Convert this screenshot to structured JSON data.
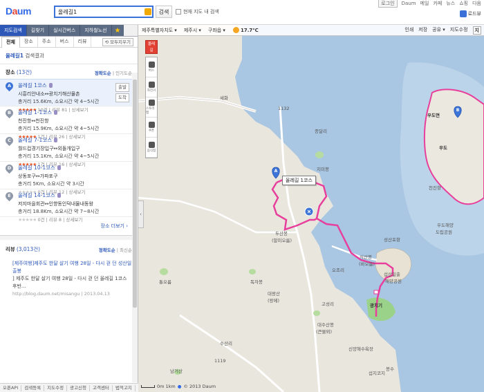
{
  "header": {
    "logo_daum": "Daum",
    "logo_map": "지도",
    "search_value": "올레길1",
    "search_button": "검색",
    "in_map_label": "현재 지도 내 검색",
    "util_links": [
      "로그인",
      "Daum",
      "메일",
      "카페",
      "뉴스",
      "쇼핑",
      "다음"
    ],
    "road_view": "로드뷰"
  },
  "left": {
    "nav_tabs": [
      "지도검색",
      "길찾기",
      "실시간버스",
      "지하철노선"
    ],
    "sub_tabs": [
      "전체",
      "장소",
      "주소",
      "버스",
      "리뷰"
    ],
    "clear_all": "모두지우기",
    "result_query": "올레길1",
    "result_suffix": "검색결과",
    "places_title": "장소",
    "places_count": "(13건)",
    "sort_accuracy": "정확도순",
    "sort_popular": "인기도순",
    "places": [
      {
        "badge": "A",
        "name": "올레길 1코스",
        "route": "시흥리안내소↔광치기해산물촌",
        "dist": "총거리 15.6Km, 소요시간 약 4~5시간",
        "stars": "★★★★★",
        "meta": "10건 | 리뷰 81 | 상세보기",
        "empty": false
      },
      {
        "badge": "B",
        "name": "올레길 1-1코스",
        "route": "천진항↔천진항",
        "dist": "총거리 15.9Km, 소요시간 약 4~5시간",
        "stars": "★★★★★",
        "meta": "1건 | 리뷰 26 | 상세보기",
        "empty": false
      },
      {
        "badge": "C",
        "name": "올레길 7-1코스",
        "route": "월드컵경기장입구↔외돌개입구",
        "dist": "총거리 15.1Km, 소요시간 약 4~5시간",
        "stars": "★★★★★",
        "meta": "1건 | 리뷰 16 | 상세보기",
        "empty": false
      },
      {
        "badge": "D",
        "name": "올레길 10-1코스",
        "route": "상동포구↔가파포구",
        "dist": "총거리 5Km, 소요시간 약 3시간",
        "stars": "★★★★★",
        "meta": "0건 | 리뷰 12 | 상세보기",
        "empty": true
      },
      {
        "badge": "E",
        "name": "올레길 14-1코스",
        "route": "저지마을회관↔인향동인덕내물내동왕",
        "dist": "총거리 18.8Km, 소요시간 약 7~8시간",
        "stars": "★★★★★",
        "meta": "0건 | 리뷰 8 | 상세보기",
        "empty": true
      }
    ],
    "place_btn_go": "출발",
    "place_btn_arrive": "도착",
    "more_places": "장소 더보기 ›",
    "review_title": "리뷰",
    "review_count": "(3,013건)",
    "review_sort_a": "정확도순",
    "review_sort_b": "최신순",
    "review": {
      "title": "[제주여행]제주도 한달 살기 여행 28일 - 다시 걷 던 성산일출봉",
      "body": "] 제주도 한달 살기 여행 28일 - 다시 걷 던 올레길 1코스 후반...",
      "url": "http://blog.daum.net/misangu | 2013.04.13"
    },
    "bottom_links": [
      "오픈API",
      "검색등록",
      "지도수정",
      "광고신청",
      "고객센터",
      "법적고지"
    ]
  },
  "map": {
    "breadcrumbs": [
      "제주특별자치도 ▾",
      "제주시 ▾",
      "구좌읍 ▾"
    ],
    "temperature": "17.7℃",
    "right_links": [
      "인쇄",
      "저장",
      "공유 ▾",
      "지도수정"
    ],
    "right_btn": "지",
    "toolbar_hot": [
      "올레",
      "길"
    ],
    "toolbar": [
      "버스",
      "자전거",
      "스토리맵",
      "쿠폰",
      "음식점"
    ],
    "callout": "올레길 1코스",
    "labels": [
      {
        "t": "세화"
      },
      {
        "t": "1132"
      },
      {
        "t": "종달리"
      },
      {
        "t": "지미봉"
      },
      {
        "t": "두산봉"
      },
      {
        "t": "(말미오름)"
      },
      {
        "t": "성산포항"
      },
      {
        "t": "식산봉"
      },
      {
        "t": "(바오름)"
      },
      {
        "t": "섭산일출"
      },
      {
        "t": "해양공원"
      },
      {
        "t": "광치기"
      },
      {
        "t": "대왕산"
      },
      {
        "t": "(왕메)"
      },
      {
        "t": "통오름"
      },
      {
        "t": "독자봉"
      },
      {
        "t": "남거산"
      },
      {
        "t": "대수산봉"
      },
      {
        "t": "(큰물뫼)"
      },
      {
        "t": "신양해수욕장"
      },
      {
        "t": "섭지코지"
      },
      {
        "t": "우도면"
      },
      {
        "t": "우도"
      },
      {
        "t": "천진항"
      },
      {
        "t": "우도해양"
      },
      {
        "t": "도립공원"
      },
      {
        "t": "1119"
      },
      {
        "t": "고성리"
      },
      {
        "t": "수산리"
      },
      {
        "t": "오조리"
      },
      {
        "t": "봉수"
      }
    ],
    "scale": "0m    1km",
    "copyright": "© 2013 Daum"
  },
  "colors": {
    "route": "#e83e9c",
    "sea": "#a8c4e0",
    "land": "#ebe8df",
    "accent": "#2d58b8"
  }
}
